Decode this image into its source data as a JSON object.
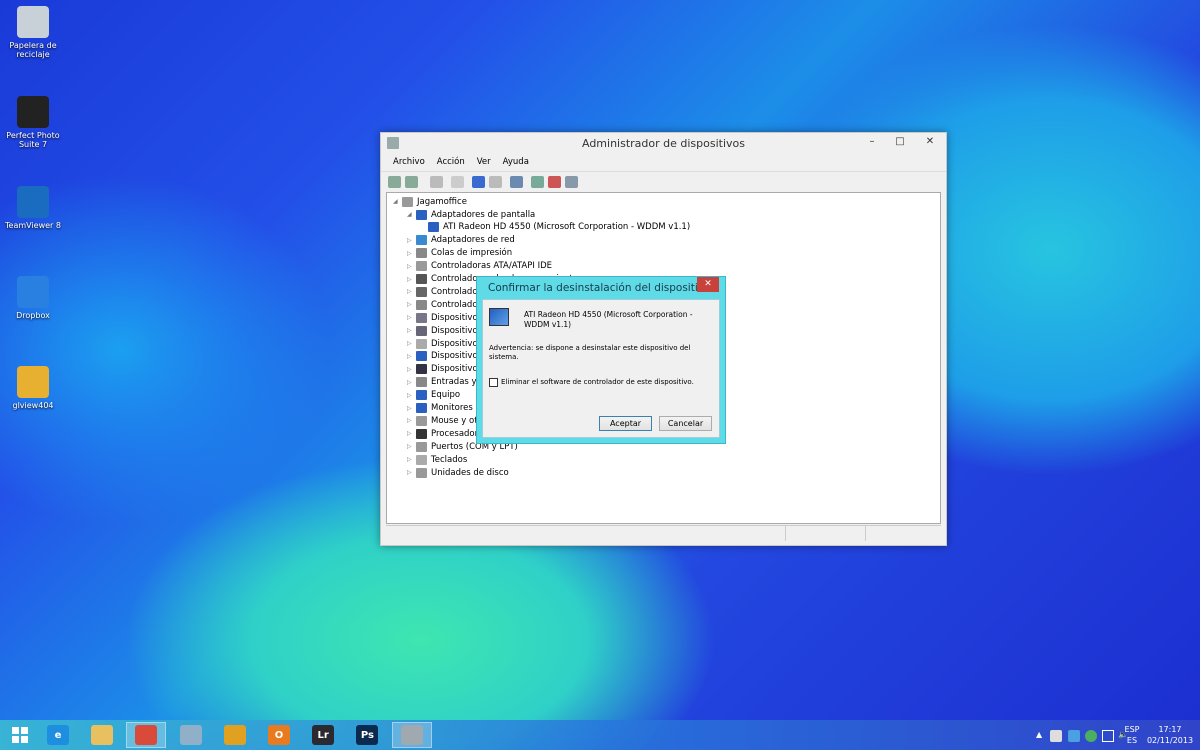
{
  "desktop": {
    "icons": [
      {
        "label": "Papelera de reciclaje",
        "icon": "recycle-bin-icon"
      },
      {
        "label": "Perfect Photo Suite 7",
        "icon": "perfect-photo-icon"
      },
      {
        "label": "TeamViewer 8",
        "icon": "teamviewer-icon"
      },
      {
        "label": "Dropbox",
        "icon": "dropbox-icon"
      },
      {
        "label": "glview404",
        "icon": "folder-icon"
      }
    ]
  },
  "window": {
    "title": "Administrador de dispositivos",
    "minimize": "–",
    "maximize": "□",
    "close": "✕",
    "menu": [
      "Archivo",
      "Acción",
      "Ver",
      "Ayuda"
    ],
    "tree": {
      "root": "Jagamoffice",
      "items": [
        {
          "label": "Adaptadores de pantalla",
          "expanded": true
        },
        {
          "label": "ATI Radeon HD 4550 (Microsoft Corporation - WDDM v1.1)",
          "child": true
        },
        {
          "label": "Adaptadores de red"
        },
        {
          "label": "Colas de impresión"
        },
        {
          "label": "Controladoras ATA/ATAPI IDE"
        },
        {
          "label": "Controladoras de almacenamiento"
        },
        {
          "label": "Controlado"
        },
        {
          "label": "Controlado"
        },
        {
          "label": "Dispositivos"
        },
        {
          "label": "Dispositivos"
        },
        {
          "label": "Dispositivos"
        },
        {
          "label": "Dispositivos"
        },
        {
          "label": "Dispositivos"
        },
        {
          "label": "Entradas y s"
        },
        {
          "label": "Equipo"
        },
        {
          "label": "Monitores"
        },
        {
          "label": "Mouse y otr"
        },
        {
          "label": "Procesadores"
        },
        {
          "label": "Puertos (COM y LPT)"
        },
        {
          "label": "Teclados"
        },
        {
          "label": "Unidades de disco"
        }
      ]
    }
  },
  "dialog": {
    "title": "Confirmar la desinstalación del dispositivo",
    "close": "✕",
    "device": "ATI Radeon HD 4550 (Microsoft Corporation - WDDM v1.1)",
    "warning": "Advertencia: se dispone a desinstalar este dispositivo del sistema.",
    "checkbox_label": "Eliminar el software de controlador de este dispositivo.",
    "checkbox_checked": false,
    "ok": "Aceptar",
    "cancel": "Cancelar"
  },
  "taskbar": {
    "apps": [
      {
        "name": "internet-explorer",
        "glyph": "e",
        "color": "#1e8ee0"
      },
      {
        "name": "file-explorer",
        "glyph": "",
        "color": "#e8c060"
      },
      {
        "name": "chrome",
        "glyph": "",
        "color": "#d94a3a",
        "active": true
      },
      {
        "name": "app-4",
        "glyph": "",
        "color": "#8fb0c8"
      },
      {
        "name": "app-5",
        "glyph": "",
        "color": "#e0a020"
      },
      {
        "name": "outlook",
        "glyph": "O",
        "color": "#e87a20"
      },
      {
        "name": "lightroom",
        "glyph": "Lr",
        "color": "#2a2a30"
      },
      {
        "name": "photoshop",
        "glyph": "Ps",
        "color": "#0a2a50"
      },
      {
        "name": "device-manager",
        "glyph": "",
        "color": "#a0a8b0",
        "active": true
      }
    ],
    "lang_top": "ESP",
    "lang_bottom": "ES",
    "time": "17:17",
    "date": "02/11/2013"
  }
}
